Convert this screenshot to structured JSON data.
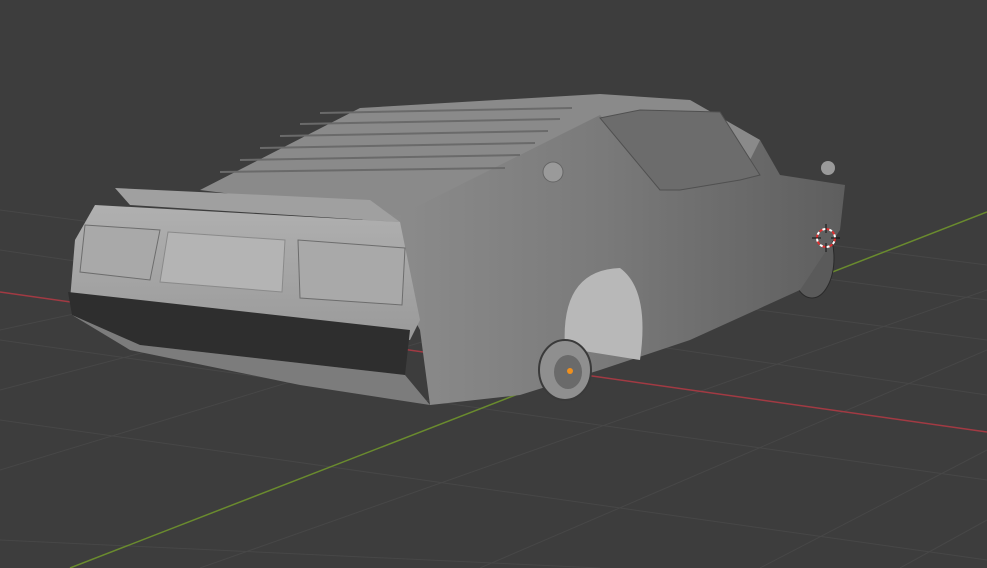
{
  "viewport": {
    "kind": "3d-viewport",
    "colors": {
      "background": "#3d3d3d",
      "grid": "#4a4a4a",
      "x_axis": "#a23a43",
      "y_axis": "#6a8b2e",
      "model_light": "#a8a8a8",
      "model_mid": "#7a7a7a",
      "model_dark": "#4e4e4e",
      "origin_dot": "#f0901e"
    },
    "icons": [
      "3d-cursor-icon",
      "object-origin-icon"
    ]
  }
}
